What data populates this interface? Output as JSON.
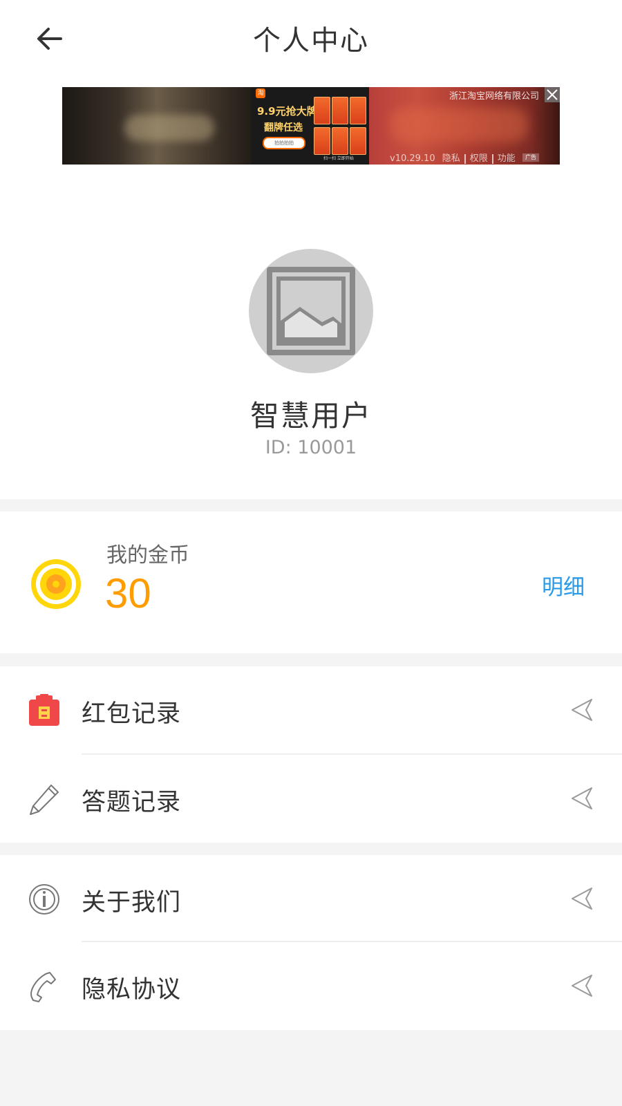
{
  "header": {
    "title": "个人中心",
    "back_icon": "back-arrow-icon"
  },
  "ad": {
    "company": "浙江淘宝网络有限公司",
    "promo_line1": "9.9元抢大牌",
    "promo_line2": "翻牌任选",
    "search_text": "拍拍拍拍",
    "version": "v10.29.10",
    "links": [
      "隐私",
      "权限",
      "功能"
    ],
    "tag": "广告",
    "bottom_text": "扫一扫 立即开始",
    "close_icon": "close-icon"
  },
  "profile": {
    "avatar_icon": "image-placeholder-icon",
    "name": "智慧用户",
    "id_text": "ID: 10001"
  },
  "coins": {
    "label": "我的金币",
    "value": "30",
    "detail_label": "明细",
    "icon": "coin-icon",
    "accent_color": "#ff9c00",
    "link_color": "#2a9ae8"
  },
  "menu": {
    "group1": [
      {
        "label": "红包记录",
        "icon": "red-envelope-icon"
      },
      {
        "label": "答题记录",
        "icon": "pencil-icon"
      }
    ],
    "group2": [
      {
        "label": "关于我们",
        "icon": "info-icon"
      },
      {
        "label": "隐私协议",
        "icon": "phone-icon"
      }
    ],
    "arrow_icon": "send-arrow-icon"
  }
}
